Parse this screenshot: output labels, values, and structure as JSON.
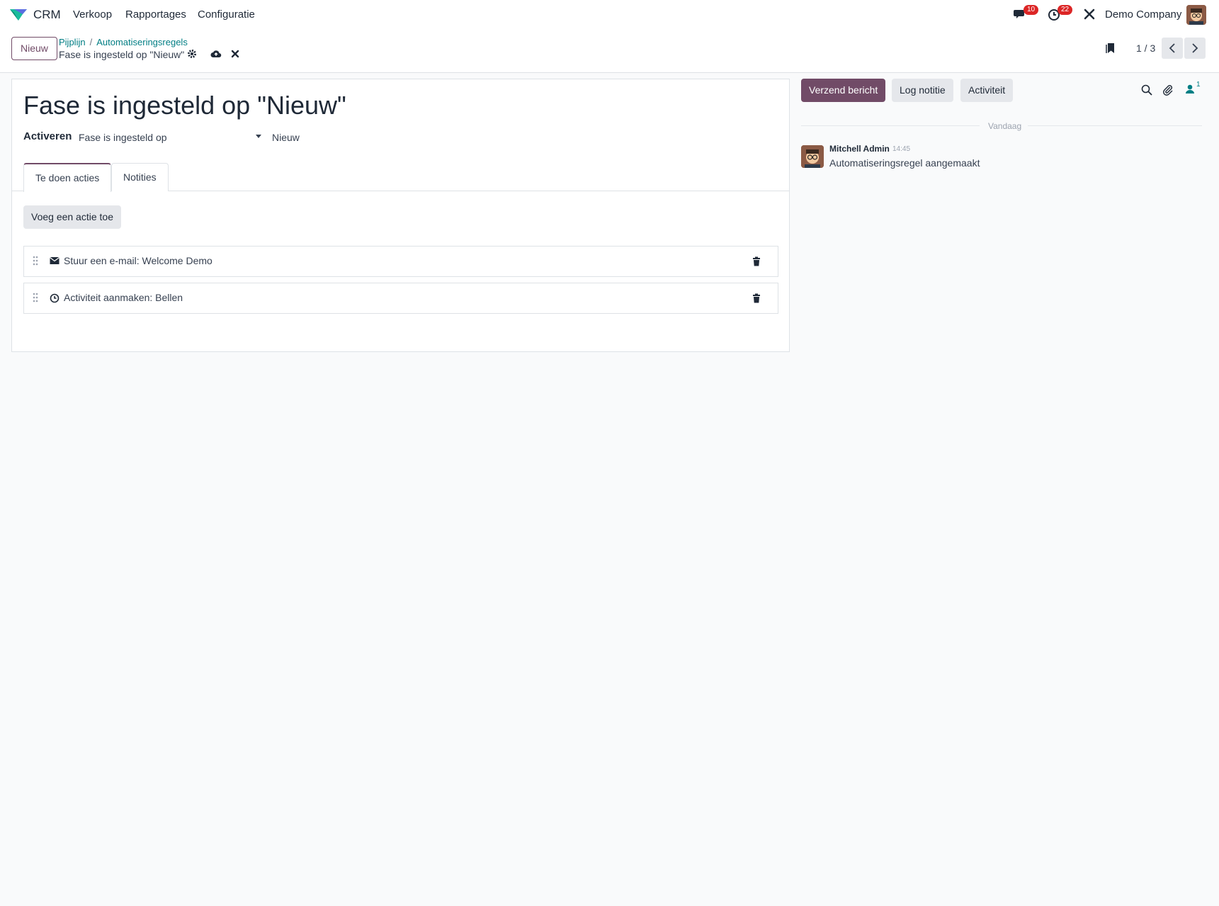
{
  "navbar": {
    "app_name": "CRM",
    "menu": [
      "Verkoop",
      "Rapportages",
      "Configuratie"
    ],
    "messages_count": "10",
    "activities_count": "22",
    "company": "Demo Company"
  },
  "control_panel": {
    "new_button": "Nieuw",
    "breadcrumb": [
      "Pijplijn",
      "Automatiseringsregels"
    ],
    "record_title": "Fase is ingesteld op \"Nieuw\"",
    "pager": "1 / 3"
  },
  "form": {
    "title": "Fase is ingesteld op \"Nieuw\"",
    "trigger_label": "Activeren",
    "trigger_select": "Fase is ingesteld op",
    "trigger_value": "Nieuw",
    "tabs": [
      "Te doen acties",
      "Notities"
    ],
    "add_action_button": "Voeg een actie toe",
    "actions": [
      {
        "icon": "envelope-icon",
        "label": "Stuur een e-mail: Welcome Demo"
      },
      {
        "icon": "clock-icon",
        "label": "Activiteit aanmaken: Bellen"
      }
    ]
  },
  "chatter": {
    "send_message": "Verzend bericht",
    "log_note": "Log notitie",
    "activity": "Activiteit",
    "followers_count": "1",
    "date_separator": "Vandaag",
    "messages": [
      {
        "author": "Mitchell Admin",
        "time": "14:45",
        "body": "Automatiseringsregel aangemaakt"
      }
    ]
  },
  "colors": {
    "brand": "#714b67",
    "link": "#017e84",
    "badge": "#dc2626"
  }
}
